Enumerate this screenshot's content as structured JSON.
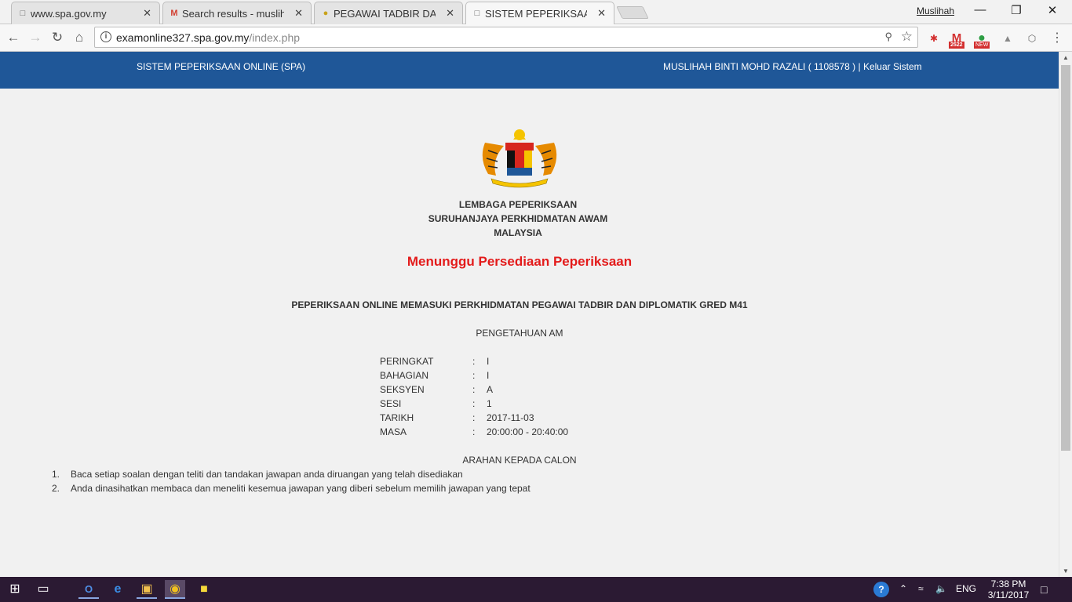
{
  "browser": {
    "tabs": [
      {
        "title": "www.spa.gov.my",
        "favicon": "page-icon"
      },
      {
        "title": "Search results - muslihah",
        "favicon": "gmail-icon"
      },
      {
        "title": "PEGAWAI TADBIR DAN DIPLOMATIK",
        "favicon": "crest-icon"
      },
      {
        "title": "SISTEM PEPERIKSAAN ONLINE",
        "favicon": "page-icon"
      }
    ],
    "profile_name": "Muslihah",
    "url_domain": "examonline327.spa.gov.my",
    "url_path": "/index.php",
    "extension_badges": {
      "gmail_count": "2522",
      "new_label": "NEW"
    }
  },
  "site": {
    "system_name": "SISTEM PEPERIKSAAN ONLINE (SPA)",
    "user_line": "MUSLIHAH BINTI MOHD RAZALI ( 1108578 ) | Keluar Sistem"
  },
  "org": {
    "line1": "LEMBAGA PEPERIKSAAN",
    "line2": "SURUHANJAYA PERKHIDMATAN AWAM",
    "line3": "MALAYSIA"
  },
  "status_heading": "Menunggu Persediaan Peperiksaan",
  "exam_title": "PEPERIKSAAN ONLINE MEMASUKI PERKHIDMATAN PEGAWAI TADBIR DAN DIPLOMATIK GRED M41",
  "subject": "PENGETAHUAN AM",
  "details": [
    {
      "label": "PERINGKAT",
      "sep": ":",
      "value": "I"
    },
    {
      "label": "BAHAGIAN",
      "sep": ":",
      "value": "I"
    },
    {
      "label": "SEKSYEN",
      "sep": ":",
      "value": "A"
    },
    {
      "label": "SESI",
      "sep": ":",
      "value": "1"
    },
    {
      "label": "TARIKH",
      "sep": ":",
      "value": "2017-11-03"
    },
    {
      "label": "MASA",
      "sep": ":",
      "value": "20:00:00 - 20:40:00"
    }
  ],
  "instructions_title": "ARAHAN KEPADA CALON",
  "instructions": [
    {
      "num": "1.",
      "text": "Baca setiap soalan dengan teliti dan tandakan jawapan anda diruangan yang telah disediakan"
    },
    {
      "num": "2.",
      "text": "Anda dinasihatkan membaca dan meneliti kesemua jawapan yang diberi sebelum memilih jawapan yang tepat"
    }
  ],
  "taskbar": {
    "language": "ENG",
    "time": "7:38 PM",
    "date": "3/11/2017"
  }
}
